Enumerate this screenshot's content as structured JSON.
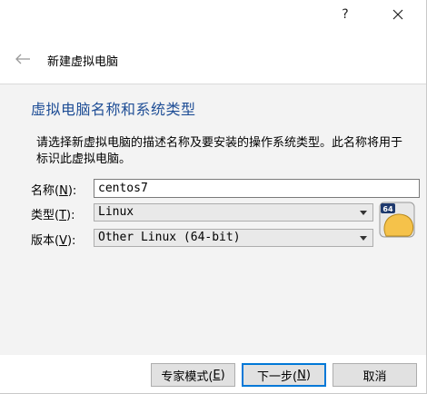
{
  "window": {
    "help_label": "?",
    "close_icon": "close-icon"
  },
  "wizard": {
    "back_icon": "back-arrow-icon",
    "title": "新建虚拟电脑"
  },
  "section": {
    "heading": "虚拟电脑名称和系统类型",
    "description": "请选择新虚拟电脑的描述名称及要安装的操作系统类型。此名称将用于标识此虚拟电脑。"
  },
  "form": {
    "name": {
      "label_prefix": "名称(",
      "label_key": "N",
      "label_suffix": "):",
      "value": "centos7"
    },
    "type": {
      "label_prefix": "类型(",
      "label_key": "T",
      "label_suffix": "):",
      "value": "Linux"
    },
    "version": {
      "label_prefix": "版本(",
      "label_key": "V",
      "label_suffix": "):",
      "value": "Other Linux (64-bit)"
    },
    "os_icon_badge": "64"
  },
  "buttons": {
    "expert": {
      "prefix": "专家模式(",
      "key": "E",
      "suffix": ")"
    },
    "next": {
      "prefix": "下一步(",
      "key": "N",
      "suffix": ")"
    },
    "cancel": "取消"
  },
  "colors": {
    "heading": "#1f4e96",
    "default_button_border": "#0078d7",
    "os_icon": "#f5c24a"
  }
}
